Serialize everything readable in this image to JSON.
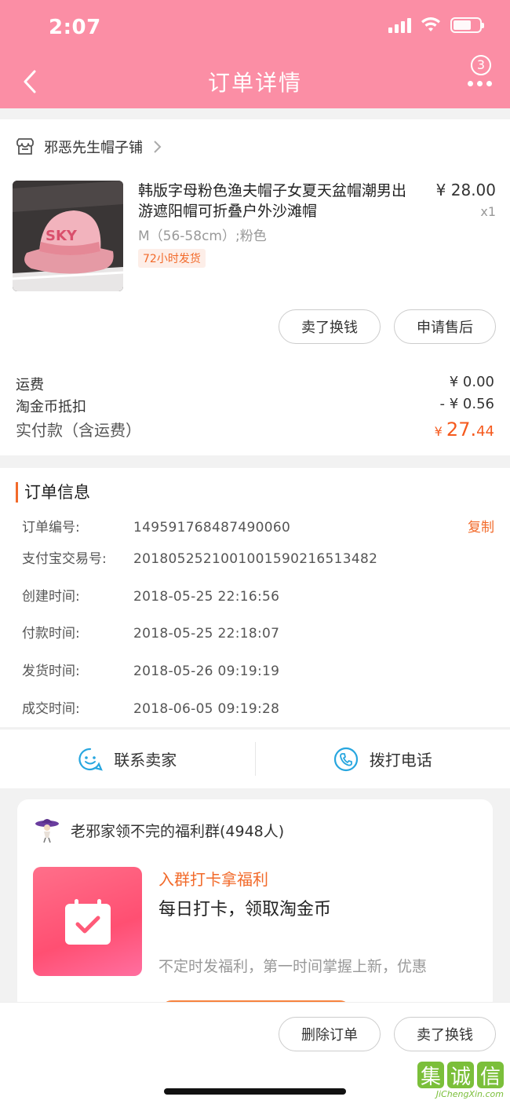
{
  "status_bar": {
    "time": "2:07"
  },
  "nav": {
    "title": "订单详情",
    "badge_count": "3"
  },
  "shop": {
    "name": "邪恶先生帽子铺"
  },
  "product": {
    "title": "韩版字母粉色渔夫帽子女夏天盆帽潮男出游遮阳帽可折叠户外沙滩帽",
    "price": "¥ 28.00",
    "quantity": "x1",
    "sku": "M（56-58cm）;粉色",
    "shipping_tag": "72小时发货",
    "image_text": "SKY",
    "sell_button": "卖了换钱",
    "aftersale_button": "申请售后"
  },
  "fees": {
    "shipping_label": "运费",
    "shipping_value": "¥ 0.00",
    "coin_label": "淘金币抵扣",
    "coin_value": "- ¥ 0.56",
    "total_label": "实付款（含运费）",
    "total_currency": "¥ ",
    "total_int": "27.",
    "total_dec": "44"
  },
  "order_info": {
    "title": "订单信息",
    "rows": [
      {
        "label": "订单编号:",
        "value": "149591768487490060"
      },
      {
        "label": "支付宝交易号:",
        "value": "2018052521001001590216513482"
      },
      {
        "label": "创建时间:",
        "value": "2018-05-25 22:16:56"
      },
      {
        "label": "付款时间:",
        "value": "2018-05-25 22:18:07"
      },
      {
        "label": "发货时间:",
        "value": "2018-05-26 09:19:19"
      },
      {
        "label": "成交时间:",
        "value": "2018-06-05 09:19:28"
      }
    ],
    "copy_label": "复制"
  },
  "contact": {
    "seller_label": "联系卖家",
    "phone_label": "拨打电话"
  },
  "group": {
    "name": "老邪家领不完的福利群(4948人)",
    "tag": "入群打卡拿福利",
    "headline": "每日打卡，领取淘金币",
    "desc": "不定时发福利，第一时间掌握上新，优惠"
  },
  "bottom_actions": {
    "delete_button": "删除订单",
    "sell_button": "卖了换钱"
  },
  "watermark": {
    "logo": [
      "集",
      "诚",
      "信"
    ],
    "text": "JiChengXin.com"
  },
  "colors": {
    "header_pink": "#fb8ea5",
    "accent_orange": "#f26a2a",
    "price_orange": "#f55a1e"
  }
}
